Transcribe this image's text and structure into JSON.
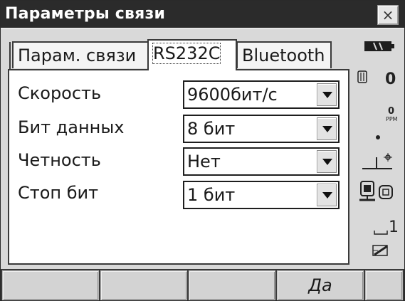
{
  "window": {
    "title": "Параметры связи",
    "close_label": "×"
  },
  "tabs": [
    {
      "label": "Парам. связи",
      "active": false
    },
    {
      "label": "RS232C",
      "active": true
    },
    {
      "label": "Bluetooth",
      "active": false
    }
  ],
  "settings": [
    {
      "label": "Скорость",
      "value": "9600бит/с"
    },
    {
      "label": "Бит данных",
      "value": "8 бит"
    },
    {
      "label": "Четность",
      "value": "Нет"
    },
    {
      "label": "Стоп бит",
      "value": "1 бит"
    }
  ],
  "status": {
    "battery_icon": "battery-full-icon",
    "count_value": "0",
    "ppm_value": "0",
    "ppm_unit": "PPM",
    "index_value": "1",
    "icons": [
      "battery-icon",
      "prism-icon",
      "ppm-icon",
      "dot-icon",
      "tilt-icon",
      "instrument-icon",
      "target-icon",
      "input-mode-icon"
    ]
  },
  "softkeys": [
    "",
    "",
    "",
    "Да",
    ""
  ]
}
